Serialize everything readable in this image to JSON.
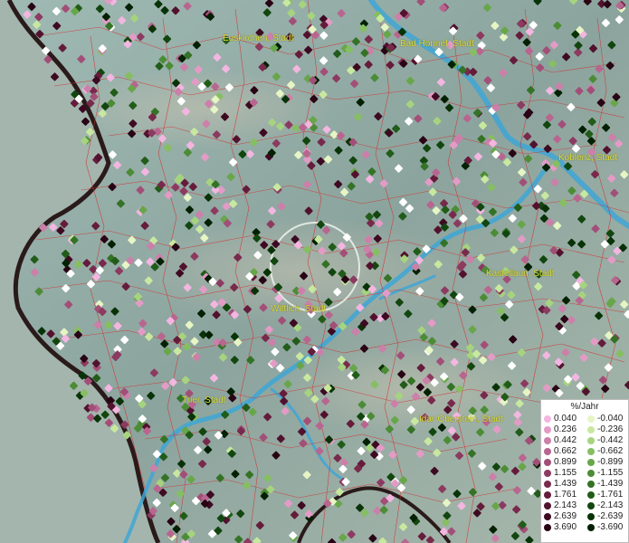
{
  "map": {
    "places": [
      {
        "id": "euskirchen",
        "name": "Euskirchen, Stadt"
      },
      {
        "id": "bad-honnef",
        "name": "Bad Honnef, Stadt"
      },
      {
        "id": "koblenz",
        "name": "Koblenz, Stadt"
      },
      {
        "id": "kastellaun",
        "name": "Kastellaun, Stadt"
      },
      {
        "id": "wittlich",
        "name": "Wittlich, Stadt"
      },
      {
        "id": "trier",
        "name": "Trier, Stadt"
      },
      {
        "id": "idar-oberstein",
        "name": "Idar-Oberstein, Stadt"
      }
    ]
  },
  "legend": {
    "title": "%/Jahr",
    "positive": [
      {
        "label": "0.040",
        "color": "#f2b6e0"
      },
      {
        "label": "0.236",
        "color": "#e39bc6"
      },
      {
        "label": "0.442",
        "color": "#cc7fa9"
      },
      {
        "label": "0.662",
        "color": "#b8668f"
      },
      {
        "label": "0.899",
        "color": "#a24f78"
      },
      {
        "label": "1.155",
        "color": "#8c3a60"
      },
      {
        "label": "1.439",
        "color": "#782a4c"
      },
      {
        "label": "1.761",
        "color": "#651c3b"
      },
      {
        "label": "2.143",
        "color": "#52122e"
      },
      {
        "label": "2.639",
        "color": "#3d0a21"
      },
      {
        "label": "3.690",
        "color": "#280414"
      }
    ],
    "negative": [
      {
        "label": "-0.040",
        "color": "#e6f5c4"
      },
      {
        "label": "-0.236",
        "color": "#c8e8a0"
      },
      {
        "label": "-0.442",
        "color": "#a6d47e"
      },
      {
        "label": "-0.662",
        "color": "#86be62"
      },
      {
        "label": "-0.899",
        "color": "#68a64a"
      },
      {
        "label": "-1.155",
        "color": "#4c8c36"
      },
      {
        "label": "-1.439",
        "color": "#347326"
      },
      {
        "label": "-1.761",
        "color": "#215c19"
      },
      {
        "label": "-2.143",
        "color": "#12460f"
      },
      {
        "label": "-2.639",
        "color": "#083307"
      },
      {
        "label": "-3.690",
        "color": "#022002"
      }
    ]
  }
}
